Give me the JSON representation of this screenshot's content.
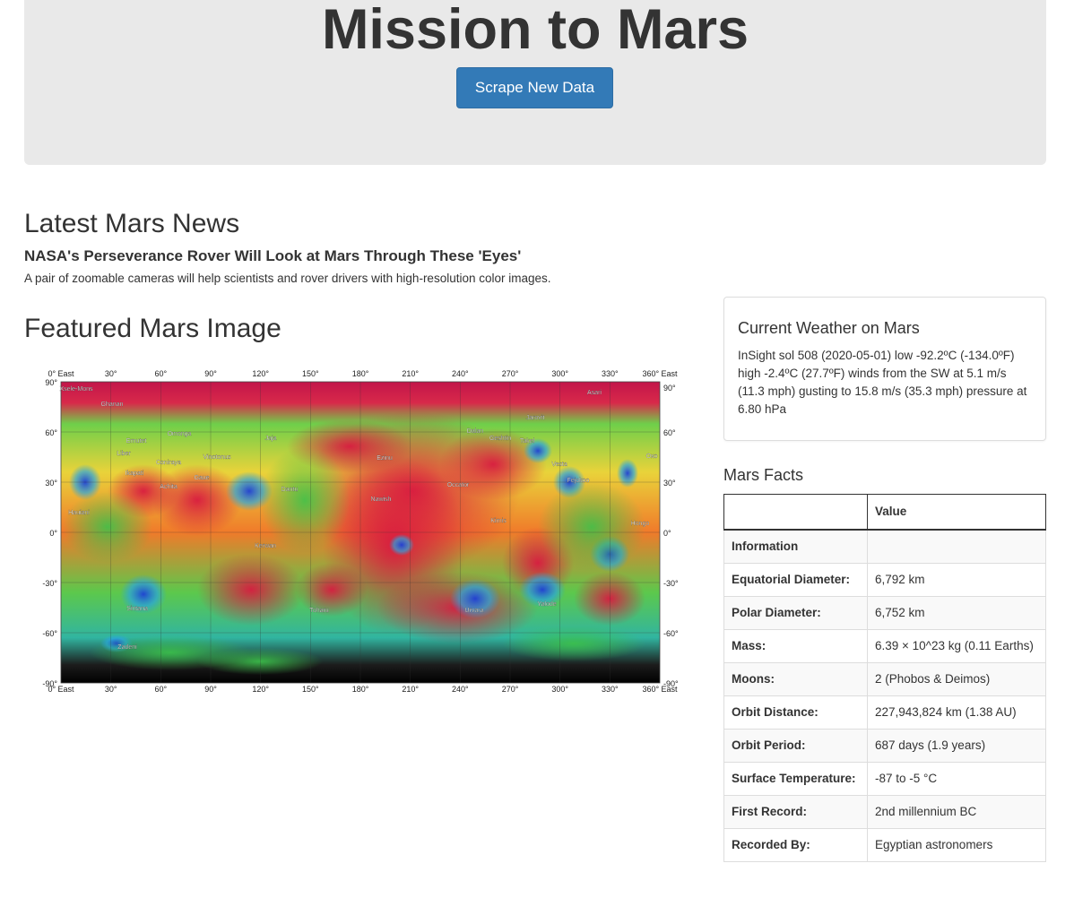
{
  "header": {
    "title": "Mission to Mars",
    "scrape_button": "Scrape New Data"
  },
  "news": {
    "heading": "Latest Mars News",
    "title": "NASA's Perseverance Rover Will Look at Mars Through These 'Eyes'",
    "teaser": "A pair of zoomable cameras will help scientists and rover drivers with high-resolution color images."
  },
  "featured": {
    "heading": "Featured Mars Image",
    "map": {
      "top_lon_labels": [
        "0° East",
        "30°",
        "60°",
        "90°",
        "120°",
        "150°",
        "180°",
        "210°",
        "240°",
        "270°",
        "300°",
        "330°",
        "360° East"
      ],
      "lat_labels": [
        "90°",
        "60°",
        "30°",
        "0°",
        "-30°",
        "-60°",
        "-90°"
      ],
      "place_names": [
        "Asari",
        "Ghanan",
        "Omonga",
        "Jaja",
        "Dalan",
        "Geshtin",
        "Jarovit",
        "Takel",
        "Ernutet",
        "Liber",
        "Vinotonus",
        "Ezinu",
        "Coniraya",
        "Ikapati",
        "Achita",
        "Gaue",
        "Dantu",
        "Occator",
        "Fejokoo",
        "Oxo",
        "Vesta",
        "Hauiani",
        "Nawish",
        "Kirnis",
        "Hongo",
        "Kerwan",
        "Sintana",
        "Toharu",
        "Urvara",
        "Yalode",
        "Zadeni",
        "Xsele-Mons"
      ],
      "colors": {
        "high": "#d61a3c",
        "mid": "#2ec34a",
        "low": "#1e4fd8",
        "mid_high": "#f7e03a"
      }
    }
  },
  "weather": {
    "title": "Current Weather on Mars",
    "text": "InSight sol 508 (2020-05-01) low -92.2ºC (-134.0ºF) high -2.4ºC (27.7ºF) winds from the SW at 5.1 m/s (11.3 mph) gusting to 15.8 m/s (35.3 mph) pressure at 6.80 hPa"
  },
  "facts": {
    "heading": "Mars Facts",
    "value_header": "Value",
    "rows": [
      {
        "label": "Information",
        "value": ""
      },
      {
        "label": "Equatorial Diameter:",
        "value": "6,792 km"
      },
      {
        "label": "Polar Diameter:",
        "value": "6,752 km"
      },
      {
        "label": "Mass:",
        "value": "6.39 × 10^23 kg (0.11 Earths)"
      },
      {
        "label": "Moons:",
        "value": "2 (Phobos & Deimos)"
      },
      {
        "label": "Orbit Distance:",
        "value": "227,943,824 km (1.38 AU)"
      },
      {
        "label": "Orbit Period:",
        "value": "687 days (1.9 years)"
      },
      {
        "label": "Surface Temperature:",
        "value": "-87 to -5 °C"
      },
      {
        "label": "First Record:",
        "value": "2nd millennium BC"
      },
      {
        "label": "Recorded By:",
        "value": "Egyptian astronomers"
      }
    ]
  }
}
